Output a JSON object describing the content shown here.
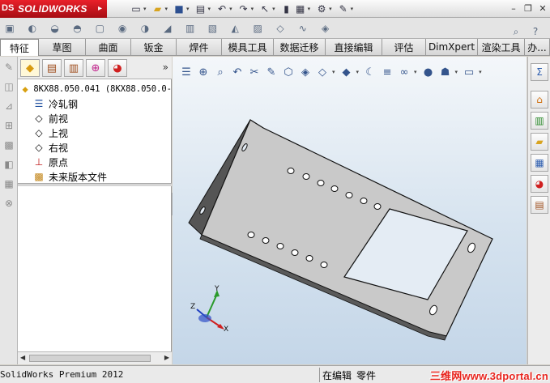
{
  "app": {
    "brand": "SOLIDWORKS"
  },
  "tabs": [
    {
      "label": "特征",
      "active": true
    },
    {
      "label": "草图"
    },
    {
      "label": "曲面"
    },
    {
      "label": "钣金"
    },
    {
      "label": "焊件"
    },
    {
      "label": "模具工具"
    },
    {
      "label": "数据迁移"
    },
    {
      "label": "直接编辑"
    },
    {
      "label": "评估"
    },
    {
      "label": "DimXpert"
    },
    {
      "label": "渲染工具"
    },
    {
      "label": "办..."
    }
  ],
  "feature_manager": {
    "more_label": "»",
    "tree": [
      {
        "label": "8KX88.050.041    (8KX88.050.0-",
        "icon": "part-icon"
      },
      {
        "label": "冷轧钢",
        "icon": "material-icon"
      },
      {
        "label": "前视",
        "icon": "plane-icon"
      },
      {
        "label": "上视",
        "icon": "plane-icon"
      },
      {
        "label": "右视",
        "icon": "plane-icon"
      },
      {
        "label": "原点",
        "icon": "origin-icon"
      },
      {
        "label": "未来版本文件",
        "icon": "future-version-icon"
      }
    ]
  },
  "triad": {
    "x": "X",
    "y": "Y",
    "z": "Z"
  },
  "status": {
    "product": "SolidWorks Premium 2012",
    "mode": "在编辑",
    "doc": "零件",
    "watermark": "三维网www.3dportal.cn"
  },
  "colors": {
    "brand_red": "#c8151c",
    "viewport_top": "#f4f7fa",
    "viewport_bottom": "#c4d6e8",
    "part_face": "#c9c9c9",
    "part_edge": "#1a1a1a",
    "watermark": "#e8261f"
  }
}
